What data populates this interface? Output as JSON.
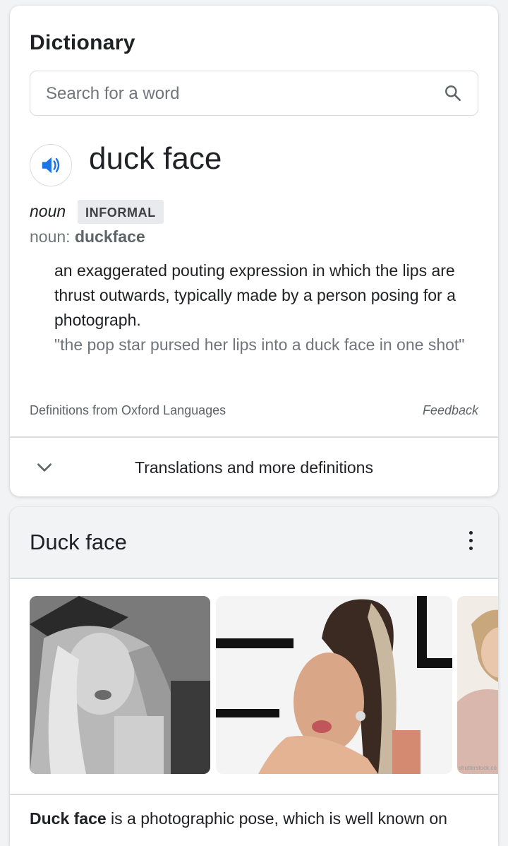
{
  "dictionary": {
    "title": "Dictionary",
    "search_placeholder": "Search for a word",
    "headword": "duck face",
    "part_of_speech": "noun",
    "register_label": "INFORMAL",
    "variant_prefix": "noun:",
    "variant_word": "duckface",
    "definition": "an exaggerated pouting expression in which the lips are thrust outwards, typically made by a person posing for a photograph.",
    "example": "\"the pop star pursed her lips into a duck face in one shot\"",
    "source": "Definitions from Oxford Languages",
    "feedback_label": "Feedback",
    "expand_label": "Translations and more definitions"
  },
  "knowledge_panel": {
    "title": "Duck face",
    "images": [
      {
        "icon": "photo-grayscale-selfie"
      },
      {
        "icon": "photo-celebrity-duck-face"
      },
      {
        "icon": "photo-partial",
        "watermark": "shutterstock.co"
      }
    ],
    "description_bold": "Duck face",
    "description_rest": " is a photographic pose, which is well known on"
  },
  "colors": {
    "accent_blue": "#1a73e8",
    "text_primary": "#202124",
    "text_secondary": "#70757a",
    "border": "#dadce0",
    "header_bg": "#f1f3f4"
  }
}
